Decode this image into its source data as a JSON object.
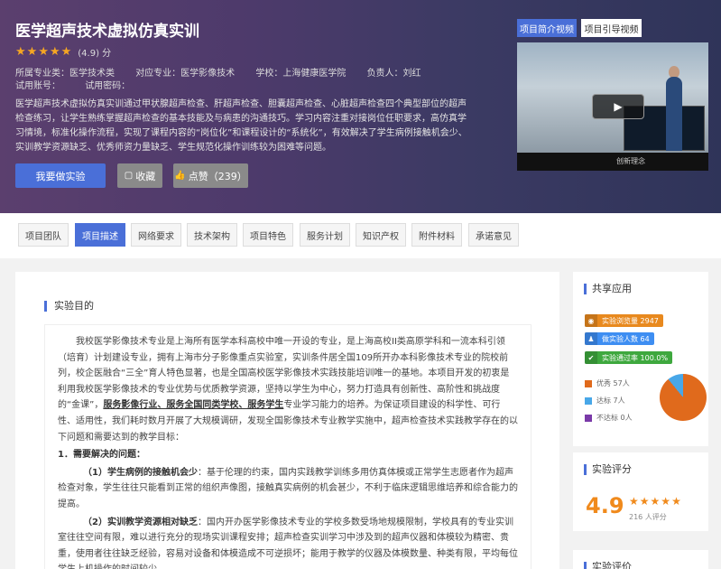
{
  "hero": {
    "title": "医学超声技术虚拟仿真实训",
    "rating_text": "(4.9) 分",
    "meta": {
      "major": "所属专业类：医学技术类",
      "target": "对应专业：医学影像技术",
      "school": "学校：上海健康医学院",
      "owner": "负责人：刘红",
      "account": "试用账号：",
      "password": "试用密码："
    },
    "description": "医学超声技术虚拟仿真实训通过甲状腺超声检查、肝超声检查、胆囊超声检查、心脏超声检查四个典型部位的超声检查练习，让学生熟练掌握超声检查的基本技能及与病患的沟通技巧。学习内容注重对接岗位任职要求，高仿真学习情境，标准化操作流程，实现了课程内容的“岗位化”和课程设计的“系统化”，有效解决了学生病例接触机会少、实训教学资源缺乏、优秀师资力量缺乏、学生规范化操作训练较为困难等问题。",
    "buttons": {
      "start": "我要做实验",
      "favorite": "收藏",
      "like": "点赞（239）"
    },
    "video_tabs": [
      "项目简介视频",
      "项目引导视频"
    ],
    "video_caption": "创新理念"
  },
  "tabs": [
    "项目团队",
    "项目描述",
    "网络要求",
    "技术架构",
    "项目特色",
    "服务计划",
    "知识产权",
    "附件材料",
    "承诺意见"
  ],
  "active_tab": "项目描述",
  "main": {
    "section_title": "实验目的",
    "p1": "我校医学影像技术专业是上海所有医学本科高校中唯一开设的专业，是上海高校II类高原学科和一流本科引领（培育）计划建设专业，拥有上海市分子影像重点实验室，实训条件居全国109所开办本科影像技术专业的院校前列，校企医融合“三全”育人特色显著，也是全国高校医学影像技术实践技能培训唯一的基地。本项目开发的初衷是利用我校医学影像技术的专业优势与优质教学资源，坚持以学生为中心，努力打造具有创新性、高阶性和挑战度的“金课”，",
    "p1_bold": "服务影像行业、服务全国同类学校、服务学生",
    "p1_tail": "专业学习能力的培养。为保证项目建设的科学性、可行性、适用性，我们耗时数月开展了大规模调研，发现全国影像技术专业教学实施中，超声检查技术实践教学存在的以下问题和需要达到的教学目标：",
    "h1": "1．需要解决的问题：",
    "q1_title": "（1）学生病例的接触机会少",
    "q1_text": "：基于伦理的约束，国内实践教学训练多用仿真体模或正常学生志愿者作为超声检查对象，学生往往只能看到正常的组织声像图，接触真实病例的机会甚少，不利于临床逻辑思维培养和综合能力的提高。",
    "q2_title": "（2）实训教学资源相对缺乏",
    "q2_text": "：国内开办医学影像技术专业的学校多数受场地规模限制，学校具有的专业实训室往往空间有限，难以进行充分的现场实训课程安排；超声检查实训学习中涉及到的超声仪器和体模较为精密、贵重，使用者往往缺乏经验，容易对设备和体模造成不可逆损坏；能用于教学的仪器及体模数量、种类有限，平均每位学生上机操作的时间较少。"
  },
  "sidebar": {
    "share_title": "共享应用",
    "stat_views": "实验浏览量 2947",
    "stat_users": "做实验人数 64",
    "stat_pass": "实验通过率 100.0%",
    "legend": [
      "优秀 57人",
      "达标 7人",
      "不达标 0人"
    ],
    "rating_title": "实验评分",
    "score": "4.9",
    "rating_count": "216 人评分",
    "review_title": "实验评价"
  },
  "colors": {
    "accent": "#4a6fd8",
    "star": "#f5a623",
    "excellent": "#e06a1c",
    "pass": "#48a7e8",
    "fail": "#7a3aa8",
    "views": "#e8891e",
    "users": "#3e8ef2",
    "rate": "#3ea83e"
  },
  "chart_data": {
    "type": "pie",
    "categories": [
      "优秀",
      "达标",
      "不达标"
    ],
    "values": [
      57,
      7,
      0
    ]
  }
}
